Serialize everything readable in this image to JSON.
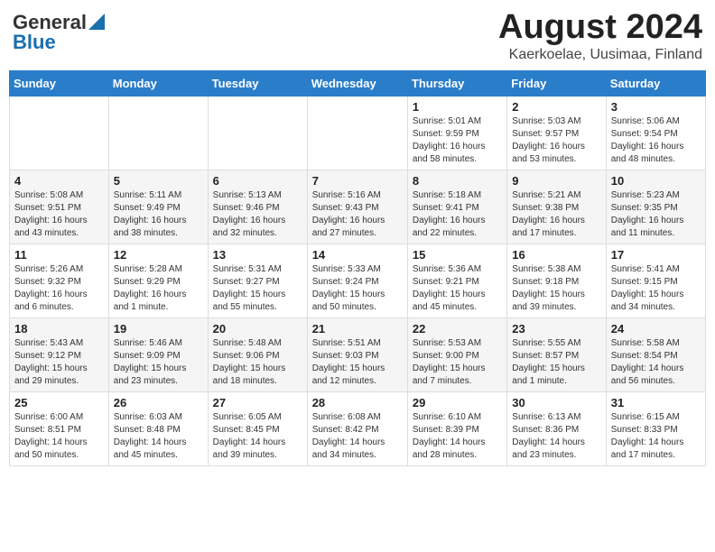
{
  "logo": {
    "general": "General",
    "blue": "Blue"
  },
  "title": {
    "month_year": "August 2024",
    "location": "Kaerkoelae, Uusimaa, Finland"
  },
  "headers": [
    "Sunday",
    "Monday",
    "Tuesday",
    "Wednesday",
    "Thursday",
    "Friday",
    "Saturday"
  ],
  "weeks": [
    [
      {
        "day": "",
        "info": ""
      },
      {
        "day": "",
        "info": ""
      },
      {
        "day": "",
        "info": ""
      },
      {
        "day": "",
        "info": ""
      },
      {
        "day": "1",
        "info": "Sunrise: 5:01 AM\nSunset: 9:59 PM\nDaylight: 16 hours\nand 58 minutes."
      },
      {
        "day": "2",
        "info": "Sunrise: 5:03 AM\nSunset: 9:57 PM\nDaylight: 16 hours\nand 53 minutes."
      },
      {
        "day": "3",
        "info": "Sunrise: 5:06 AM\nSunset: 9:54 PM\nDaylight: 16 hours\nand 48 minutes."
      }
    ],
    [
      {
        "day": "4",
        "info": "Sunrise: 5:08 AM\nSunset: 9:51 PM\nDaylight: 16 hours\nand 43 minutes."
      },
      {
        "day": "5",
        "info": "Sunrise: 5:11 AM\nSunset: 9:49 PM\nDaylight: 16 hours\nand 38 minutes."
      },
      {
        "day": "6",
        "info": "Sunrise: 5:13 AM\nSunset: 9:46 PM\nDaylight: 16 hours\nand 32 minutes."
      },
      {
        "day": "7",
        "info": "Sunrise: 5:16 AM\nSunset: 9:43 PM\nDaylight: 16 hours\nand 27 minutes."
      },
      {
        "day": "8",
        "info": "Sunrise: 5:18 AM\nSunset: 9:41 PM\nDaylight: 16 hours\nand 22 minutes."
      },
      {
        "day": "9",
        "info": "Sunrise: 5:21 AM\nSunset: 9:38 PM\nDaylight: 16 hours\nand 17 minutes."
      },
      {
        "day": "10",
        "info": "Sunrise: 5:23 AM\nSunset: 9:35 PM\nDaylight: 16 hours\nand 11 minutes."
      }
    ],
    [
      {
        "day": "11",
        "info": "Sunrise: 5:26 AM\nSunset: 9:32 PM\nDaylight: 16 hours\nand 6 minutes."
      },
      {
        "day": "12",
        "info": "Sunrise: 5:28 AM\nSunset: 9:29 PM\nDaylight: 16 hours\nand 1 minute."
      },
      {
        "day": "13",
        "info": "Sunrise: 5:31 AM\nSunset: 9:27 PM\nDaylight: 15 hours\nand 55 minutes."
      },
      {
        "day": "14",
        "info": "Sunrise: 5:33 AM\nSunset: 9:24 PM\nDaylight: 15 hours\nand 50 minutes."
      },
      {
        "day": "15",
        "info": "Sunrise: 5:36 AM\nSunset: 9:21 PM\nDaylight: 15 hours\nand 45 minutes."
      },
      {
        "day": "16",
        "info": "Sunrise: 5:38 AM\nSunset: 9:18 PM\nDaylight: 15 hours\nand 39 minutes."
      },
      {
        "day": "17",
        "info": "Sunrise: 5:41 AM\nSunset: 9:15 PM\nDaylight: 15 hours\nand 34 minutes."
      }
    ],
    [
      {
        "day": "18",
        "info": "Sunrise: 5:43 AM\nSunset: 9:12 PM\nDaylight: 15 hours\nand 29 minutes."
      },
      {
        "day": "19",
        "info": "Sunrise: 5:46 AM\nSunset: 9:09 PM\nDaylight: 15 hours\nand 23 minutes."
      },
      {
        "day": "20",
        "info": "Sunrise: 5:48 AM\nSunset: 9:06 PM\nDaylight: 15 hours\nand 18 minutes."
      },
      {
        "day": "21",
        "info": "Sunrise: 5:51 AM\nSunset: 9:03 PM\nDaylight: 15 hours\nand 12 minutes."
      },
      {
        "day": "22",
        "info": "Sunrise: 5:53 AM\nSunset: 9:00 PM\nDaylight: 15 hours\nand 7 minutes."
      },
      {
        "day": "23",
        "info": "Sunrise: 5:55 AM\nSunset: 8:57 PM\nDaylight: 15 hours\nand 1 minute."
      },
      {
        "day": "24",
        "info": "Sunrise: 5:58 AM\nSunset: 8:54 PM\nDaylight: 14 hours\nand 56 minutes."
      }
    ],
    [
      {
        "day": "25",
        "info": "Sunrise: 6:00 AM\nSunset: 8:51 PM\nDaylight: 14 hours\nand 50 minutes."
      },
      {
        "day": "26",
        "info": "Sunrise: 6:03 AM\nSunset: 8:48 PM\nDaylight: 14 hours\nand 45 minutes."
      },
      {
        "day": "27",
        "info": "Sunrise: 6:05 AM\nSunset: 8:45 PM\nDaylight: 14 hours\nand 39 minutes."
      },
      {
        "day": "28",
        "info": "Sunrise: 6:08 AM\nSunset: 8:42 PM\nDaylight: 14 hours\nand 34 minutes."
      },
      {
        "day": "29",
        "info": "Sunrise: 6:10 AM\nSunset: 8:39 PM\nDaylight: 14 hours\nand 28 minutes."
      },
      {
        "day": "30",
        "info": "Sunrise: 6:13 AM\nSunset: 8:36 PM\nDaylight: 14 hours\nand 23 minutes."
      },
      {
        "day": "31",
        "info": "Sunrise: 6:15 AM\nSunset: 8:33 PM\nDaylight: 14 hours\nand 17 minutes."
      }
    ]
  ]
}
